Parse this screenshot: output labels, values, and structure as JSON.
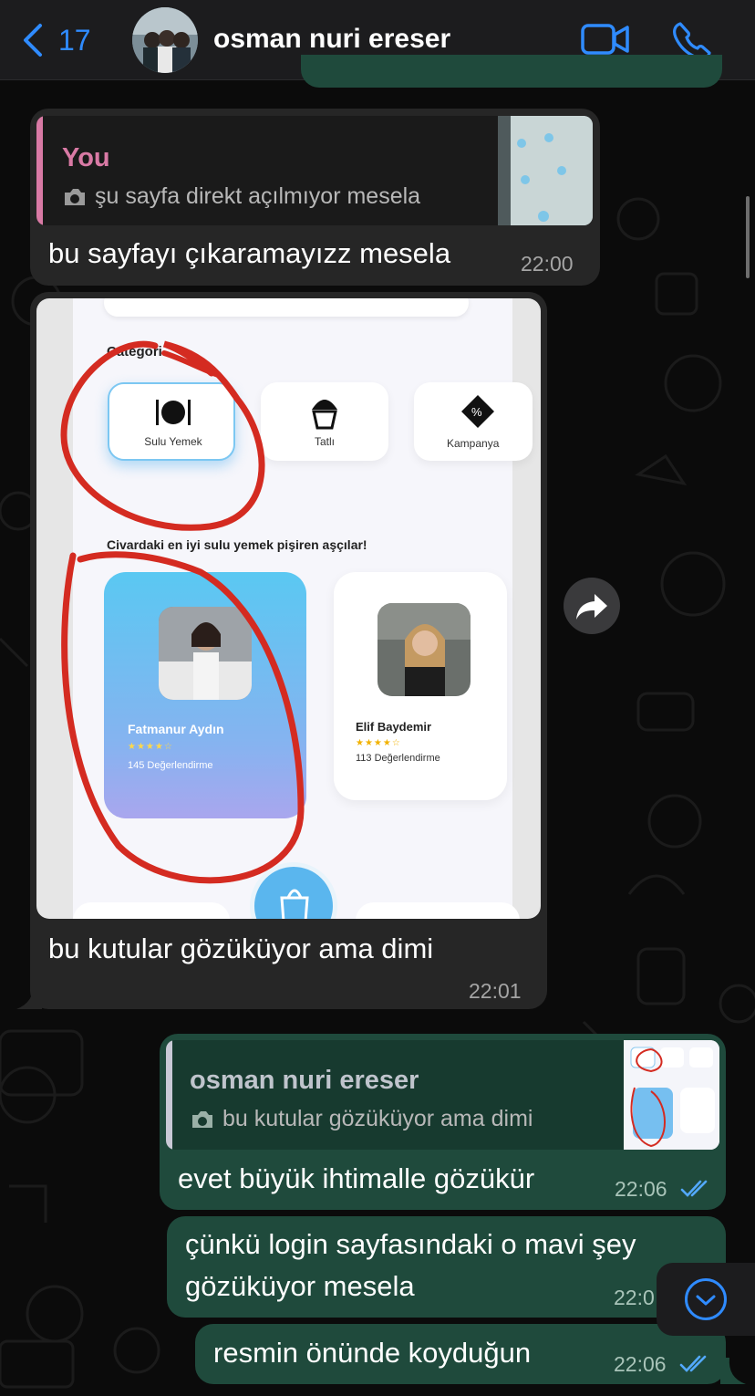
{
  "header": {
    "back_count": "17",
    "contact_name": "osman nuri ereser"
  },
  "messages": [
    {
      "id": "m1",
      "direction": "incoming",
      "quote": {
        "author": "You",
        "text": "şu sayfa direkt açılmıyor mesela"
      },
      "text": "bu sayfayı çıkaramayızz mesela",
      "time": "22:00"
    },
    {
      "id": "m2",
      "direction": "incoming",
      "image": {
        "category_heading": "Categori",
        "categories": [
          "Sulu Yemek",
          "Tatlı",
          "Kampanya"
        ],
        "section_heading": "Civardaki en iyi sulu yemek pişiren aşçılar!",
        "cooks": [
          {
            "name": "Fatmanur Aydın",
            "reviews": "145 Değerlendirme",
            "stars": 4
          },
          {
            "name": "Elif Baydemir",
            "reviews": "113 Değerlendirme",
            "stars": 4
          }
        ]
      },
      "text": "bu kutular gözüküyor ama dimi",
      "time": "22:01"
    },
    {
      "id": "m3",
      "direction": "outgoing",
      "quote": {
        "author": "osman nuri ereser",
        "text": "bu kutular gözüküyor ama dimi"
      },
      "text": "evet büyük ihtimalle gözükür",
      "time": "22:06"
    },
    {
      "id": "m4",
      "direction": "outgoing",
      "text_line1": "çünkü login sayfasındaki o mavi şey",
      "text_line2": "gözüküyor mesela",
      "time": "22:0"
    },
    {
      "id": "m5",
      "direction": "outgoing",
      "text": "resmin önünde koyduğun",
      "time": "22:06"
    }
  ],
  "colors": {
    "accent": "#2f8bff",
    "incoming_bubble": "#262626",
    "outgoing_bubble": "#1f4a3c",
    "you_quote_name": "#d97aa5",
    "read_ticks": "#53a9ff"
  }
}
